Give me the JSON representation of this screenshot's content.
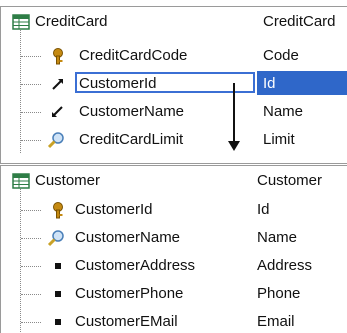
{
  "tables": [
    {
      "name": "CreditCard",
      "type": "CreditCard",
      "attributes": [
        {
          "name": "CreditCardCode",
          "type": "Code",
          "icon": "key-icon"
        },
        {
          "name": "CustomerId",
          "type": "Id",
          "icon": "foreign-key-arrow-icon"
        },
        {
          "name": "CustomerName",
          "type": "Name",
          "icon": "inferred-arrow-icon"
        },
        {
          "name": "CreditCardLimit",
          "type": "Limit",
          "icon": "magnifier-icon"
        }
      ]
    },
    {
      "name": "Customer",
      "type": "Customer",
      "attributes": [
        {
          "name": "CustomerId",
          "type": "Id",
          "icon": "key-icon"
        },
        {
          "name": "CustomerName",
          "type": "Name",
          "icon": "magnifier-icon"
        },
        {
          "name": "CustomerAddress",
          "type": "Address",
          "icon": "bullet-icon"
        },
        {
          "name": "CustomerPhone",
          "type": "Phone",
          "icon": "bullet-icon"
        },
        {
          "name": "CustomerEMail",
          "type": "Email",
          "icon": "bullet-icon"
        }
      ]
    }
  ],
  "selection": {
    "table_index": 0,
    "attribute_index": 1
  },
  "colors": {
    "selection_fill": "#2f67c9",
    "selection_border": "#3b6fd4",
    "key_icon": "#c58a12",
    "table_icon": "#2e7d46"
  }
}
